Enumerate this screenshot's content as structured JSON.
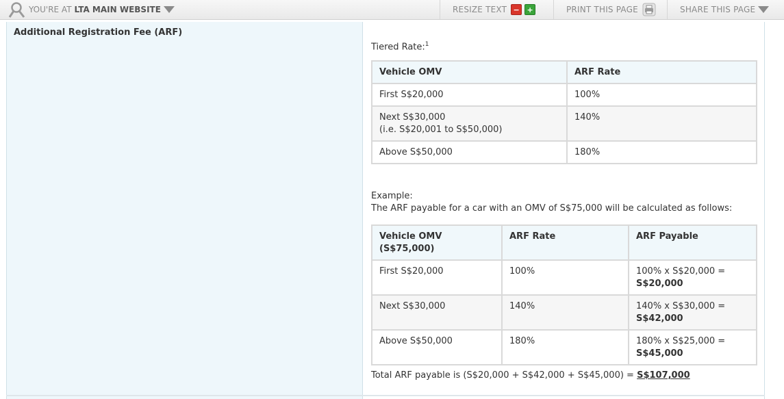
{
  "toolbar": {
    "location_prefix": "YOU'RE AT",
    "location_site": "LTA MAIN WEBSITE",
    "resize_text_label": "RESIZE TEXT",
    "decrease_symbol": "−",
    "increase_symbol": "+",
    "print_label": "PRINT THIS PAGE",
    "share_label": "SHARE THIS PAGE",
    "icons": [
      "ribbon-icon",
      "chevron-down-icon",
      "minus-icon",
      "plus-icon",
      "printer-icon",
      "chevron-down-icon"
    ],
    "colors": {
      "decrease_button": "#d9362b",
      "increase_button": "#3aa43a"
    }
  },
  "row": {
    "title": "Additional Registration Fee (ARF)"
  },
  "tiered": {
    "label": "Tiered Rate:",
    "footnote_mark": "1",
    "headers": [
      "Vehicle OMV",
      "ARF Rate"
    ],
    "rows": [
      {
        "omv": "First S$20,000",
        "omv_note": "",
        "rate": "100%"
      },
      {
        "omv": "Next S$30,000",
        "omv_note": "(i.e. S$20,001 to S$50,000)",
        "rate": "140%"
      },
      {
        "omv": "Above S$50,000",
        "omv_note": "",
        "rate": "180%"
      }
    ]
  },
  "example": {
    "label": "Example:",
    "description": "The ARF payable for a car with an OMV of S$75,000 will be calculated as follows:",
    "headers": [
      "Vehicle OMV",
      "(S$75,000)",
      "ARF Rate",
      "ARF Payable"
    ],
    "rows": [
      {
        "omv": "First S$20,000",
        "rate": "100%",
        "calc": "100% x S$20,000 =",
        "payable": "S$20,000"
      },
      {
        "omv": "Next S$30,000",
        "rate": "140%",
        "calc": "140% x S$30,000 =",
        "payable": "S$42,000"
      },
      {
        "omv": "Above S$50,000",
        "rate": "180%",
        "calc": "180% x S$25,000 =",
        "payable": "S$45,000"
      }
    ],
    "total_text": "Total ARF payable is (S$20,000 + S$42,000 + S$45,000) = ",
    "total_amount": "S$107,000"
  }
}
